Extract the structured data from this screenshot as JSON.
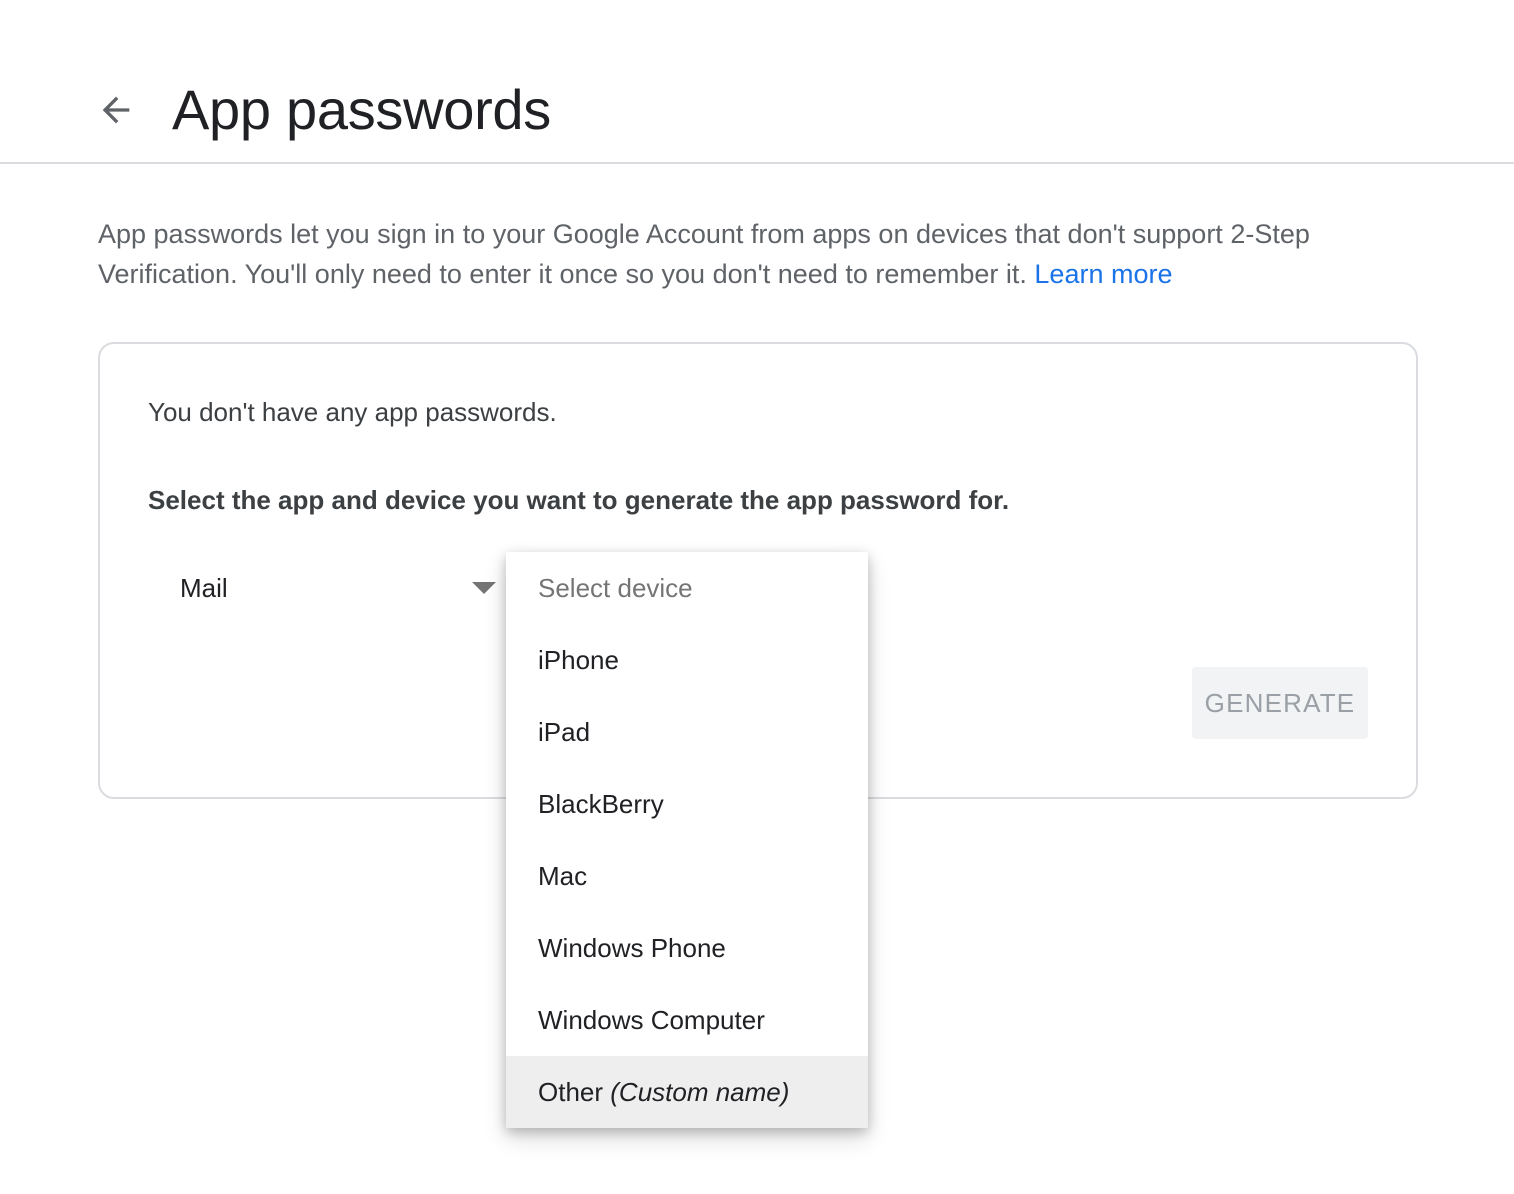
{
  "header": {
    "back_icon": "arrow-back-icon",
    "title": "App passwords"
  },
  "description": {
    "text": "App passwords let you sign in to your Google Account from apps on devices that don't support 2-Step Verification. You'll only need to enter it once so you don't need to remember it.",
    "link_label": "Learn more"
  },
  "card": {
    "empty_message": "You don't have any app passwords.",
    "instruction": "Select the app and device you want to generate the app password for.",
    "app_select": {
      "value": "Mail"
    },
    "generate_label": "GENERATE"
  },
  "device_menu": {
    "placeholder": "Select device",
    "options": [
      "iPhone",
      "iPad",
      "BlackBerry",
      "Mac",
      "Windows Phone",
      "Windows Computer"
    ],
    "other": {
      "label": "Other",
      "hint": "(Custom name)"
    },
    "highlighted": "Other (Custom name)"
  },
  "colors": {
    "link": "#1a73e8",
    "divider": "#dadce0",
    "button_disabled_bg": "#f1f3f4",
    "button_disabled_text": "#9aa0a6",
    "menu_highlight": "#eeeeee"
  }
}
